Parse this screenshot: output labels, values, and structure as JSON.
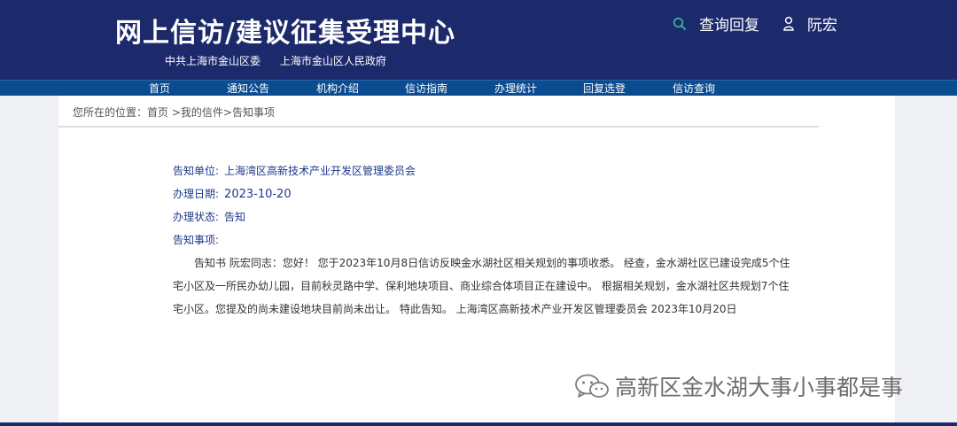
{
  "header": {
    "site_title": "网上信访/建议征集受理中心",
    "orgs": [
      "中共上海市金山区委",
      "上海市金山区人民政府"
    ],
    "query_label": "查询回复",
    "user_name": "阮宏",
    "icons": {
      "search": "search-icon",
      "user": "user-icon"
    }
  },
  "nav": {
    "items": [
      {
        "label": "首页"
      },
      {
        "label": "通知公告"
      },
      {
        "label": "机构介绍"
      },
      {
        "label": "信访指南"
      },
      {
        "label": "办理统计"
      },
      {
        "label": "回复选登"
      },
      {
        "label": "信访查询"
      }
    ]
  },
  "breadcrumb": {
    "prefix": "您所在的位置：",
    "home": "首页",
    "sep1": " >",
    "my_letters": "我的信件",
    "sep2": ">",
    "current": "告知事项"
  },
  "notice": {
    "unit_label": "告知单位:",
    "unit_value": "上海湾区高新技术产业开发区管理委员会",
    "date_label": "办理日期:",
    "date_value": "2023-10-20",
    "status_label": "办理状态:",
    "status_value": "告知",
    "matters_label": "告知事项:",
    "content": "告知书 阮宏同志：您好！ 您于2023年10月8日信访反映金水湖社区相关规划的事项收悉。 经查，金水湖社区已建设完成5个住宅小区及一所民办幼儿园，目前秋灵路中学、保利地块项目、商业综合体项目正在建设中。 根据相关规划，金水湖社区共规划7个住宅小区。您提及的尚未建设地块目前尚未出让。 特此告知。 上海湾区高新技术产业开发区管理委员会 2023年10月20日"
  },
  "watermark": {
    "text": "高新区金水湖大事小事都是事",
    "icon": "wechat-icon"
  },
  "colors": {
    "header_bg": "#1c2a6b",
    "nav_bg": "#0b4b8f",
    "field_text": "#1c3a8a"
  }
}
